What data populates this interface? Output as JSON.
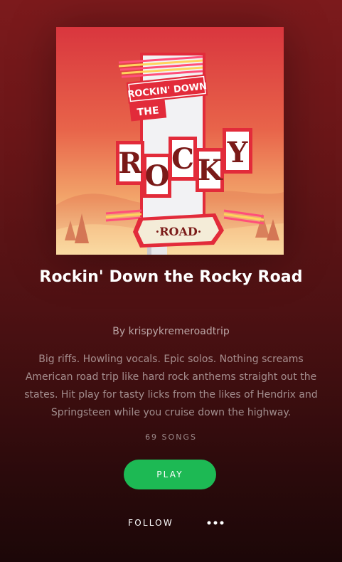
{
  "playlist": {
    "cover_art": {
      "alt": "Playlist cover art",
      "sign_lines": [
        "ROCKIN' DOWN",
        "THE",
        "ROCKY",
        "·ROAD·"
      ]
    },
    "title": "Rockin' Down the Rocky Road",
    "owner_prefix": "By",
    "owner_name": "krispykremeroadtrip",
    "description": "Big riffs. Howling vocals. Epic solos. Nothing screams American road trip like hard rock anthems straight out the states. Hit play for tasty licks from the likes of Hendrix and Springsteen while you cruise down the highway.",
    "song_count": "69 SONGS"
  },
  "actions": {
    "play_label": "PLAY",
    "follow_label": "FOLLOW",
    "more_icon": "ellipsis-icon"
  },
  "colors": {
    "background_top": "#7c1a1c",
    "background_bottom": "#1c0708",
    "play_button": "#1db954",
    "text_primary": "#ffffff"
  }
}
